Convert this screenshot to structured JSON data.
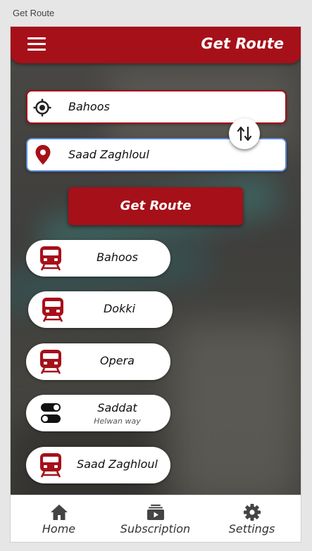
{
  "window": {
    "title": "Get Route"
  },
  "appbar": {
    "title": "Get Route",
    "menu_icon": "hamburger-menu-icon"
  },
  "form": {
    "from_value": "Bahoos",
    "to_value": "Saad Zaghloul",
    "from_icon": "crosshair-location-icon",
    "to_icon": "map-pin-icon",
    "swap_icon": "swap-vertical-arrows-icon",
    "submit_label": "Get Route"
  },
  "stations": [
    {
      "name": "Bahoos",
      "sub": "",
      "icon": "train-icon"
    },
    {
      "name": "Dokki",
      "sub": "",
      "icon": "train-icon"
    },
    {
      "name": "Opera",
      "sub": "",
      "icon": "train-icon"
    },
    {
      "name": "Saddat",
      "sub": "Helwan way",
      "icon": "toggle-switch-icon"
    },
    {
      "name": "Saad Zaghloul",
      "sub": "",
      "icon": "train-icon"
    }
  ],
  "nav": [
    {
      "label": "Home",
      "icon": "home-icon"
    },
    {
      "label": "Subscription",
      "icon": "subscription-icon"
    },
    {
      "label": "Settings",
      "icon": "gear-icon"
    }
  ],
  "colors": {
    "primary": "#a61019",
    "focus_border": "#5b8ad6",
    "surface": "#ffffff"
  }
}
